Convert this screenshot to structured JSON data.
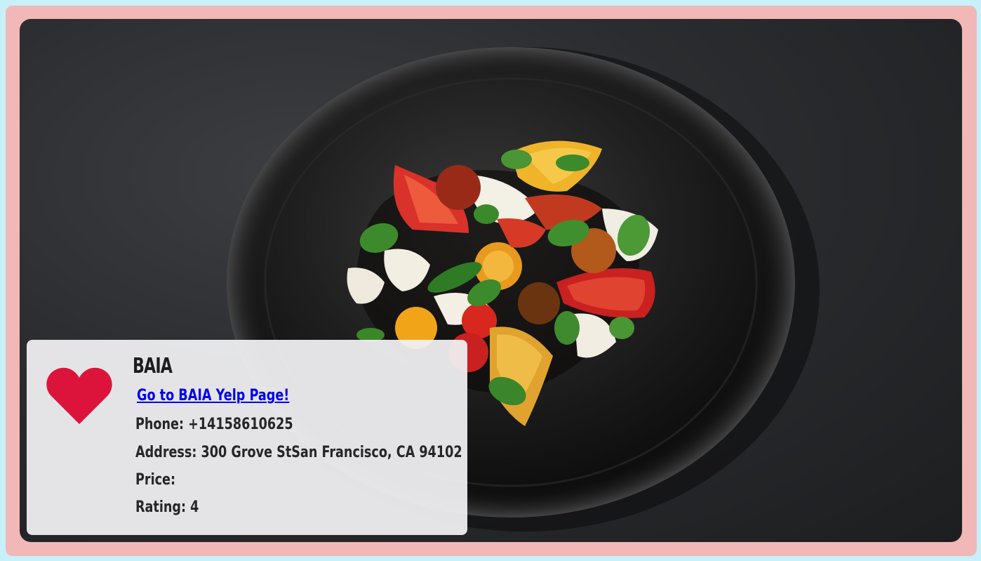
{
  "restaurant": {
    "name": "BAIA",
    "yelp_link_label": "Go to BAIA Yelp Page!",
    "phone": "Phone: +14158610625",
    "address": "Address: 300 Grove StSan Francisco, CA 94102",
    "price": "Price:",
    "rating": "Rating: 4"
  },
  "colors": {
    "background": "#c7f0fb",
    "frame": "#f2b7b7",
    "heart": "#dc143c",
    "link": "#0000ee"
  },
  "icons": {
    "favorite": "heart-icon"
  }
}
